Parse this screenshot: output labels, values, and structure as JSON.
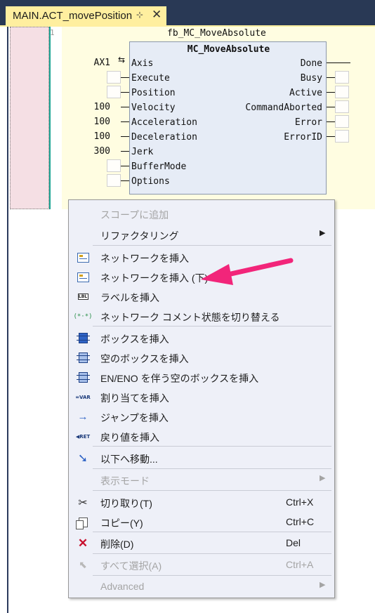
{
  "tab": {
    "title": "MAIN.ACT_movePosition",
    "pin_glyph": "⊹",
    "close_glyph": "✕"
  },
  "editor": {
    "line_number": "1",
    "instance_name": "fb_MC_MoveAbsolute",
    "fb_type": "MC_MoveAbsolute",
    "inputs": [
      {
        "name": "Axis",
        "value": "AX1"
      },
      {
        "name": "Execute",
        "value": ""
      },
      {
        "name": "Position",
        "value": ""
      },
      {
        "name": "Velocity",
        "value": "100"
      },
      {
        "name": "Acceleration",
        "value": "100"
      },
      {
        "name": "Deceleration",
        "value": "100"
      },
      {
        "name": "Jerk",
        "value": "300"
      },
      {
        "name": "BufferMode",
        "value": ""
      },
      {
        "name": "Options",
        "value": ""
      }
    ],
    "outputs": [
      {
        "name": "Done"
      },
      {
        "name": "Busy"
      },
      {
        "name": "Active"
      },
      {
        "name": "CommandAborted"
      },
      {
        "name": "Error"
      },
      {
        "name": "ErrorID"
      }
    ]
  },
  "context_menu": {
    "items": [
      {
        "label": "スコープに追加",
        "shortcut": "",
        "enabled": false,
        "submenu": false,
        "icon": ""
      },
      {
        "label": "リファクタリング",
        "shortcut": "",
        "enabled": true,
        "submenu": true,
        "icon": ""
      },
      {
        "label": "ネットワークを挿入",
        "shortcut": "",
        "enabled": true,
        "submenu": false,
        "icon": "insert-network-icon"
      },
      {
        "label": "ネットワークを挿入 (下)",
        "shortcut": "",
        "enabled": true,
        "submenu": false,
        "icon": "insert-network-below-icon"
      },
      {
        "label": "ラベルを挿入",
        "shortcut": "",
        "enabled": true,
        "submenu": false,
        "icon": "label-icon"
      },
      {
        "label": "ネットワーク コメント状態を切り替える",
        "shortcut": "",
        "enabled": true,
        "submenu": false,
        "icon": "comment-toggle-icon"
      },
      {
        "label": "ボックスを挿入",
        "shortcut": "",
        "enabled": true,
        "submenu": false,
        "icon": "box-icon"
      },
      {
        "label": "空のボックスを挿入",
        "shortcut": "",
        "enabled": true,
        "submenu": false,
        "icon": "empty-box-icon"
      },
      {
        "label": "EN/ENO を伴う空のボックスを挿入",
        "shortcut": "",
        "enabled": true,
        "submenu": false,
        "icon": "en-eno-box-icon"
      },
      {
        "label": "割り当てを挿入",
        "shortcut": "",
        "enabled": true,
        "submenu": false,
        "icon": "assignment-icon"
      },
      {
        "label": "ジャンプを挿入",
        "shortcut": "",
        "enabled": true,
        "submenu": false,
        "icon": "jump-icon"
      },
      {
        "label": "戻り値を挿入",
        "shortcut": "",
        "enabled": true,
        "submenu": false,
        "icon": "return-icon"
      },
      {
        "label": "以下へ移動...",
        "shortcut": "",
        "enabled": true,
        "submenu": false,
        "icon": "move-down-icon"
      },
      {
        "label": "表示モード",
        "shortcut": "",
        "enabled": false,
        "submenu": true,
        "icon": ""
      },
      {
        "label": "切り取り(T)",
        "shortcut": "Ctrl+X",
        "enabled": true,
        "submenu": false,
        "icon": "scissors-icon"
      },
      {
        "label": "コピー(Y)",
        "shortcut": "Ctrl+C",
        "enabled": true,
        "submenu": false,
        "icon": "copy-icon"
      },
      {
        "label": "削除(D)",
        "shortcut": "Del",
        "enabled": true,
        "submenu": false,
        "icon": "delete-icon"
      },
      {
        "label": "すべて選択(A)",
        "shortcut": "Ctrl+A",
        "enabled": false,
        "submenu": false,
        "icon": "select-all-icon"
      },
      {
        "label": "Advanced",
        "shortcut": "",
        "enabled": false,
        "submenu": true,
        "icon": ""
      }
    ],
    "icon_text": {
      "label_icon": "LBL",
      "comment_icon": "(*·*)",
      "assignment_icon": "=VAR",
      "return_icon": "◀RET"
    },
    "submenu_glyph": "▶"
  },
  "colors": {
    "tab_background": "#ffef9f",
    "tabstrip_background": "#293955",
    "editor_background": "#fffde1",
    "fb_box_fill": "#e6ecf6",
    "menu_background": "#eef0f8",
    "annotation_arrow": "#f2257a"
  }
}
